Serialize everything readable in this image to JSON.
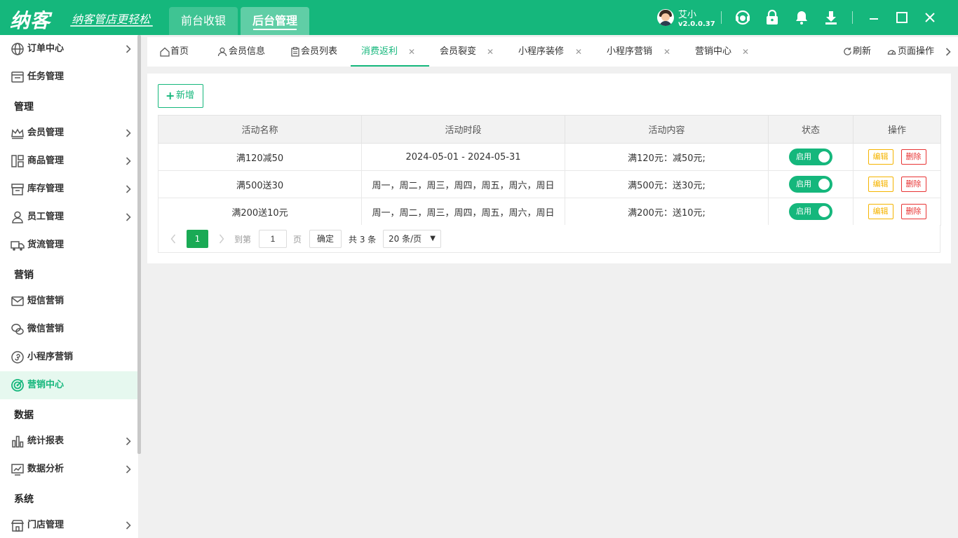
{
  "app": {
    "logo": "纳客",
    "slogan": "纳客管店更轻松",
    "top_tabs": [
      "前台收银",
      "后台管理"
    ],
    "user_name": "艾小",
    "version": "v2.0.0.37",
    "brand_color": "#15b77c"
  },
  "sidebar": {
    "items": [
      {
        "label": "订单中心",
        "icon": "globe-icon",
        "arrow": true
      },
      {
        "label": "任务管理",
        "icon": "task-icon",
        "arrow": false
      },
      {
        "label": "会员管理",
        "icon": "crown-icon",
        "arrow": true
      },
      {
        "label": "商品管理",
        "icon": "goods-icon",
        "arrow": true
      },
      {
        "label": "库存管理",
        "icon": "box-icon",
        "arrow": true
      },
      {
        "label": "员工管理",
        "icon": "user-icon",
        "arrow": true
      },
      {
        "label": "货流管理",
        "icon": "truck-icon",
        "arrow": false
      },
      {
        "label": "短信营销",
        "icon": "mail-icon",
        "arrow": false
      },
      {
        "label": "微信营销",
        "icon": "wechat-icon",
        "arrow": false
      },
      {
        "label": "小程序营销",
        "icon": "miniprogram-icon",
        "arrow": false
      },
      {
        "label": "营销中心",
        "icon": "target-icon",
        "arrow": false,
        "active": true
      },
      {
        "label": "统计报表",
        "icon": "bar-chart-icon",
        "arrow": true
      },
      {
        "label": "数据分析",
        "icon": "trend-icon",
        "arrow": true
      },
      {
        "label": "门店管理",
        "icon": "store-icon",
        "arrow": true
      }
    ],
    "groups": [
      "管理",
      "营销",
      "数据",
      "系统"
    ]
  },
  "tabs": {
    "items": [
      {
        "label": "首页",
        "icon": "home-icon",
        "closable": false
      },
      {
        "label": "会员信息",
        "icon": "person-icon",
        "closable": false
      },
      {
        "label": "会员列表",
        "icon": "clipboard-icon",
        "closable": false
      },
      {
        "label": "消费返利",
        "closable": true,
        "active": true
      },
      {
        "label": "会员裂变",
        "closable": true
      },
      {
        "label": "小程序装修",
        "closable": true
      },
      {
        "label": "小程序营销",
        "closable": true
      },
      {
        "label": "营销中心",
        "closable": true
      }
    ],
    "refresh_label": "刷新",
    "page_ops_label": "页面操作",
    "close_glyph": "✕"
  },
  "toolbar": {
    "add_label": "新增"
  },
  "table": {
    "columns": [
      "活动名称",
      "活动时段",
      "活动内容",
      "状态",
      "操作"
    ],
    "rows": [
      {
        "name": "满120减50",
        "period": "2024-05-01 - 2024-05-31",
        "content": "满120元：减50元;",
        "status": "启用"
      },
      {
        "name": "满500送30",
        "period": "周一，周二，周三，周四，周五，周六，周日",
        "content": "满500元：送30元;",
        "status": "启用"
      },
      {
        "name": "满200送10元",
        "period": "周一，周二，周三，周四，周五，周六，周日",
        "content": "满200元：送10元;",
        "status": "启用"
      }
    ],
    "edit_label": "编辑",
    "delete_label": "删除"
  },
  "pager": {
    "current_page": "1",
    "goto_label": "到第",
    "page_input_value": "1",
    "page_unit": "页",
    "confirm_label": "确定",
    "total_text": "共 3 条",
    "page_size": "20 条/页"
  }
}
